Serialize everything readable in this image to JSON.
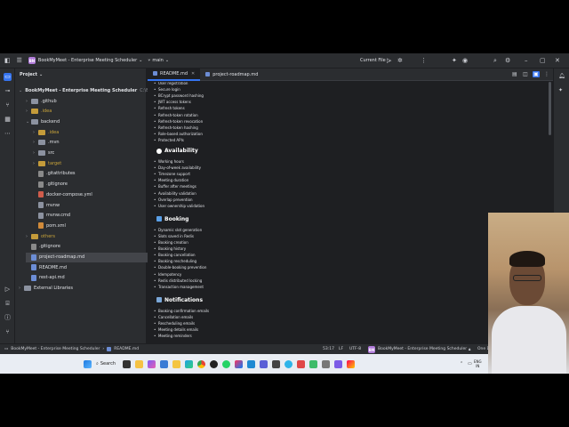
{
  "titlebar": {
    "project_badge": "BN",
    "project_name": "BookMyMeet - Enterprise Meeting Scheduler",
    "branch": "main",
    "run_config": "Current File"
  },
  "project_panel": {
    "title": "Project",
    "root": "BookMyMeet - Enterprise Meeting Scheduler",
    "root_path": "C:\\BOOK",
    "items": [
      {
        "label": ".github",
        "type": "folder",
        "depth": 1,
        "chevron": "›"
      },
      {
        "label": ".idea",
        "type": "folder-excluded",
        "depth": 1,
        "chevron": "›"
      },
      {
        "label": "backend",
        "type": "folder",
        "depth": 1,
        "chevron": "⌄"
      },
      {
        "label": ".idea",
        "type": "folder-excluded",
        "depth": 2,
        "chevron": "›"
      },
      {
        "label": ".mvn",
        "type": "folder",
        "depth": 2,
        "chevron": "›"
      },
      {
        "label": "src",
        "type": "folder",
        "depth": 2,
        "chevron": "›"
      },
      {
        "label": "target",
        "type": "folder-excluded",
        "depth": 2,
        "chevron": "›"
      },
      {
        "label": ".gitattributes",
        "type": "file",
        "depth": 2,
        "chevron": ""
      },
      {
        "label": ".gitignore",
        "type": "file",
        "depth": 2,
        "chevron": ""
      },
      {
        "label": "docker-compose.yml",
        "type": "file",
        "depth": 2,
        "chevron": ""
      },
      {
        "label": "mvnw",
        "type": "file",
        "depth": 2,
        "chevron": ""
      },
      {
        "label": "mvnw.cmd",
        "type": "file",
        "depth": 2,
        "chevron": ""
      },
      {
        "label": "pom.xml",
        "type": "file",
        "depth": 2,
        "chevron": ""
      },
      {
        "label": "others",
        "type": "folder-excluded",
        "depth": 1,
        "chevron": "›"
      },
      {
        "label": ".gitignore",
        "type": "file",
        "depth": 1,
        "chevron": ""
      },
      {
        "label": "project-roadmap.md",
        "type": "file",
        "depth": 1,
        "chevron": ""
      },
      {
        "label": "README.md",
        "type": "file",
        "depth": 1,
        "chevron": ""
      },
      {
        "label": "rest-api.md",
        "type": "file",
        "depth": 1,
        "chevron": ""
      },
      {
        "label": "External Libraries",
        "type": "folder",
        "depth": 0,
        "chevron": "›"
      }
    ]
  },
  "tabs": [
    {
      "label": "README.md",
      "active": true
    },
    {
      "label": "project-roadmap.md",
      "active": false
    }
  ],
  "editor": {
    "top_items": [
      "User registration",
      "Secure login",
      "BCrypt password hashing",
      "JWT access tokens",
      "Refresh tokens",
      "Refresh-token rotation",
      "Refresh-token revocation",
      "Refresh-token hashing",
      "Role-based authorization",
      "Protected APIs"
    ],
    "sections": [
      {
        "title": "Availability",
        "icon": "circle-icon",
        "items": [
          "Working hours",
          "Day-of-week availability",
          "Timezone support",
          "Meeting duration",
          "Buffer after meetings",
          "Availability validation",
          "Overlap prevention",
          "User ownership validation"
        ]
      },
      {
        "title": "Booking",
        "icon": "calendar-icon",
        "items": [
          "Dynamic slot generation",
          "Slots saved in Redis",
          "Booking creation",
          "Booking history",
          "Booking cancellation",
          "Booking rescheduling",
          "Double-booking prevention",
          "Idempotency",
          "Redis distributed locking",
          "Transaction management"
        ]
      },
      {
        "title": "Notifications",
        "icon": "mail-icon",
        "items": [
          "Booking confirmation emails",
          "Cancellation emails",
          "Rescheduling emails",
          "Meeting details emails",
          "Meeting reminders"
        ]
      }
    ]
  },
  "statusbar": {
    "breadcrumb_root": "BookMyMeet - Enterprise Meeting Scheduler",
    "breadcrumb_file": "README.md",
    "position": "53:17",
    "line_ending": "LF",
    "encoding": "UTF-8",
    "project_badge": "BN",
    "project_name": "BookMyMeet - Enterprise Meeting Scheduler",
    "extra": "One D"
  },
  "taskbar": {
    "search_label": "Search",
    "lang_top": "ENG",
    "lang_bottom": "IN"
  },
  "colors": {
    "accent": "#3574f0",
    "bg": "#1e1f22",
    "panel": "#2b2d30"
  }
}
